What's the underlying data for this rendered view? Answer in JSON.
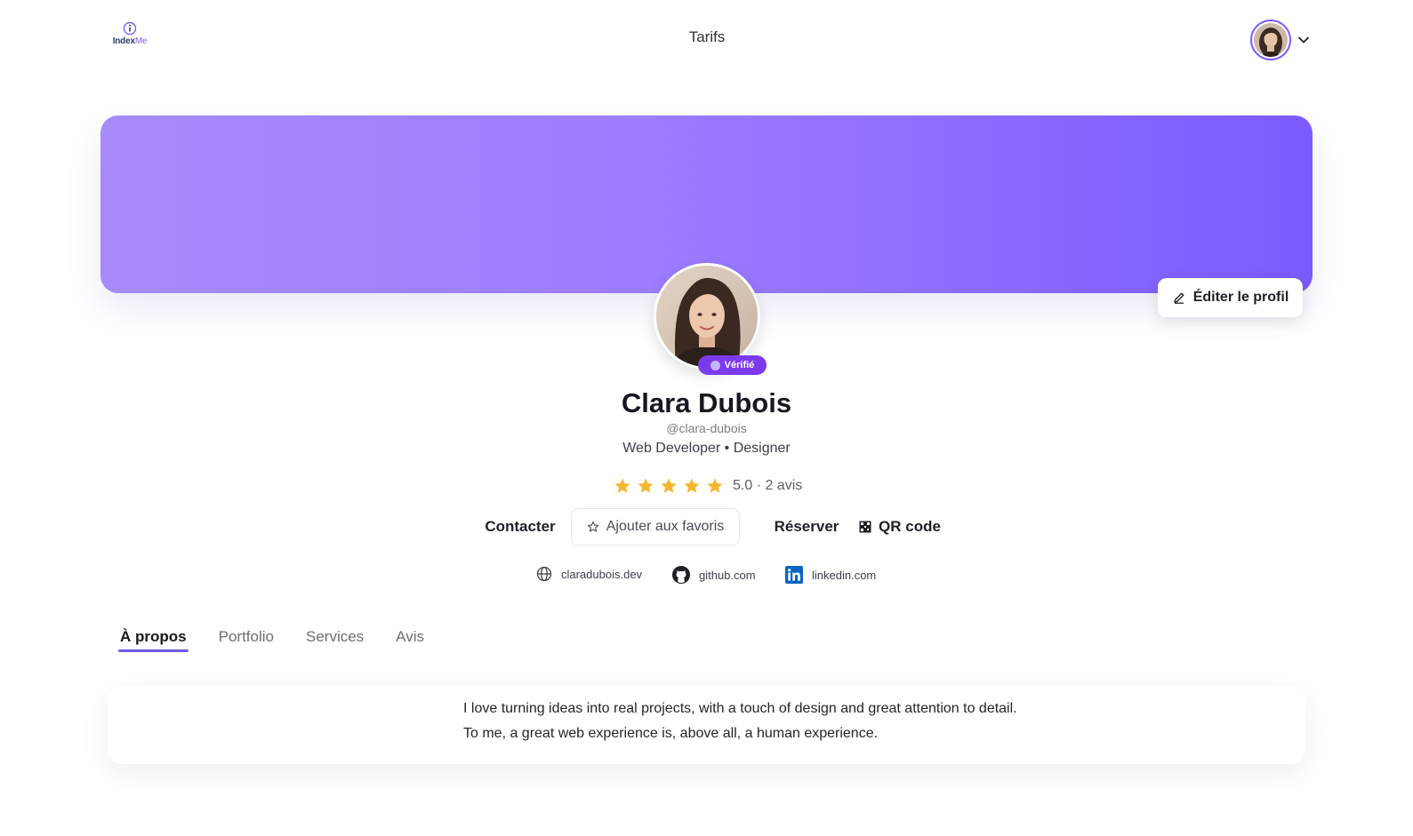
{
  "header": {
    "logo_text_a": "Index",
    "logo_text_b": "Me",
    "nav_pricing": "Tarifs",
    "avatar_icon": "user-avatar",
    "dropdown_icon": "chevron-down-icon"
  },
  "banner": {
    "edit_label": "Éditer le profil",
    "edit_icon": "pencil-icon",
    "gradient_start": "#a78bfa",
    "gradient_end": "#7b5bfd"
  },
  "profile": {
    "verified_label": "Vérifié",
    "name": "Clara Dubois",
    "handle": "@clara-dubois",
    "role": "Web Developer • Designer",
    "rating_value": 5.0,
    "rating_max": 5,
    "rating_text": "5.0 · 2 avis"
  },
  "actions": {
    "contact": "Contacter",
    "favorite": "Ajouter aux favoris",
    "favorite_icon": "star-outline-icon",
    "reserve": "Réserver",
    "qr": "QR code",
    "qr_icon": "qr-code-icon"
  },
  "links": [
    {
      "icon": "globe-icon",
      "label": "claradubois.dev"
    },
    {
      "icon": "github-icon",
      "label": "github.com"
    },
    {
      "icon": "linkedin-icon",
      "label": "linkedin.com"
    }
  ],
  "tabs": [
    {
      "label": "À propos",
      "active": true
    },
    {
      "label": "Portfolio",
      "active": false
    },
    {
      "label": "Services",
      "active": false
    },
    {
      "label": "Avis",
      "active": false
    }
  ],
  "about": {
    "line1": "I love turning ideas into real projects, with a touch of design and great attention to detail.",
    "line2": "To me, a great web experience is, above all, a human experience."
  },
  "colors": {
    "accent": "#7c5cff",
    "badge": "#7c3aed",
    "star": "#f5b731",
    "tab_underline": "#6d5cf0"
  }
}
